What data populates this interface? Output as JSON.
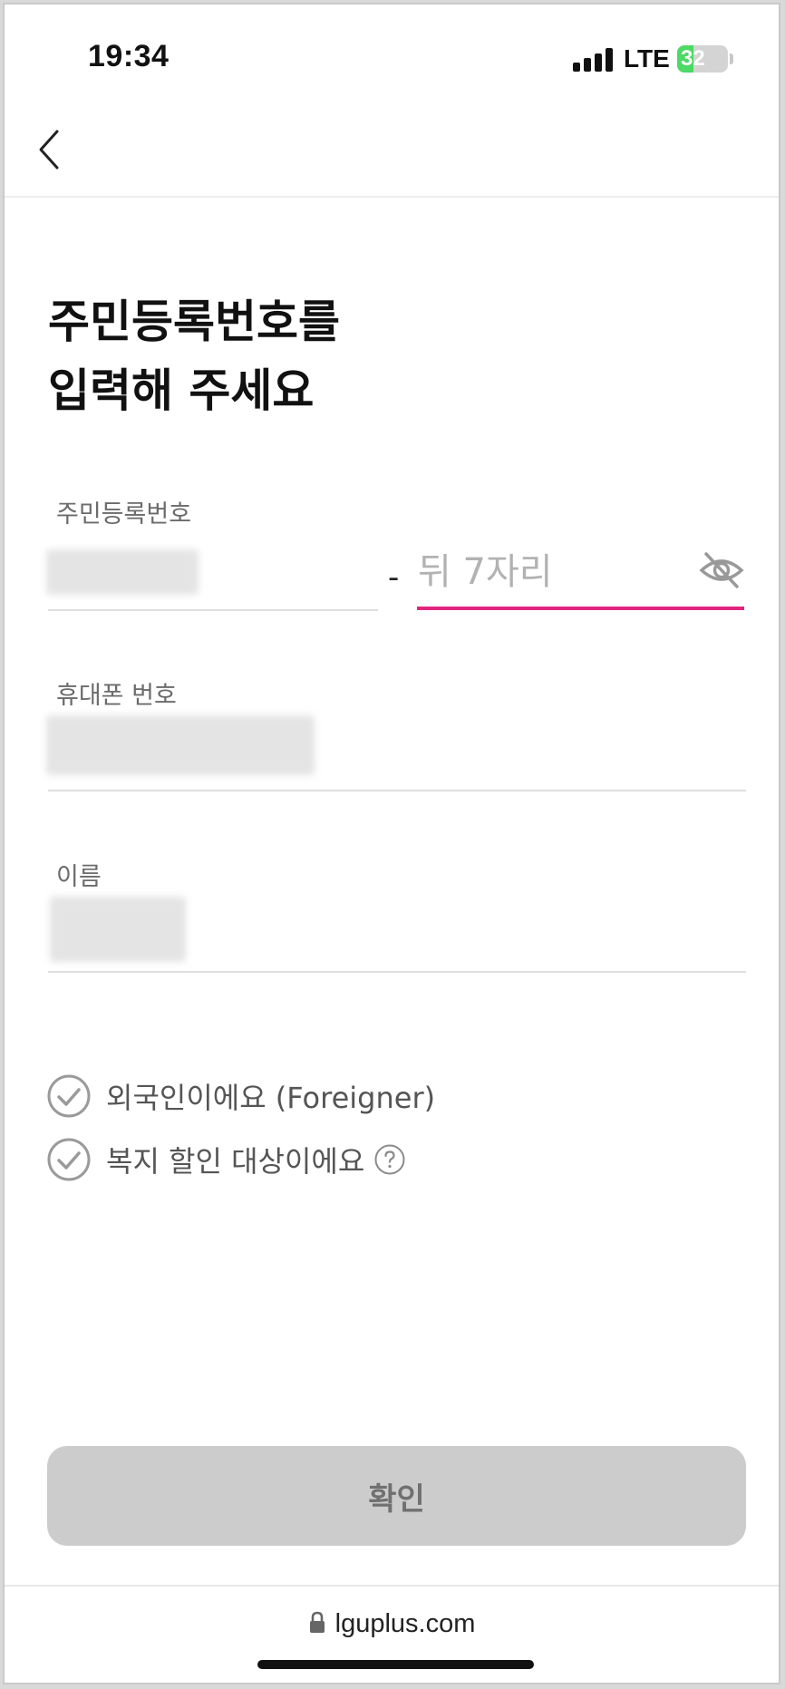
{
  "status_bar": {
    "time": "19:34",
    "network": "LTE",
    "battery_percent": "32",
    "battery_level": 0.32,
    "battery_color": "#4cd964"
  },
  "header": {
    "back_icon": "chevron-left-icon"
  },
  "title": {
    "line1": "주민등록번호를",
    "line2": "입력해 주세요"
  },
  "form": {
    "rrn": {
      "label": "주민등록번호",
      "separator": "-",
      "back_placeholder": "뒤 7자리",
      "visibility_icon": "eye-off-icon",
      "active_color": "#e1257f"
    },
    "phone": {
      "label": "휴대폰 번호"
    },
    "name": {
      "label": "이름"
    }
  },
  "options": {
    "foreigner": {
      "label": "외국인이에요 (Foreigner)",
      "icon": "check-circle-icon"
    },
    "welfare": {
      "label": "복지 할인 대상이에요",
      "icon": "check-circle-icon",
      "help_icon": "question-circle-icon"
    }
  },
  "confirm_button": {
    "label": "확인"
  },
  "browser": {
    "url": "lguplus.com",
    "lock_icon": "lock-icon"
  }
}
